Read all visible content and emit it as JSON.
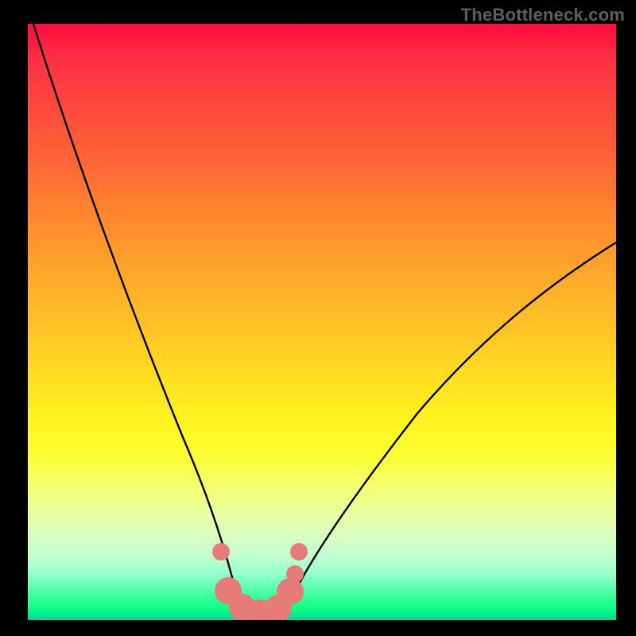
{
  "watermark": "TheBottleneck.com",
  "colors": {
    "frame": "#000000",
    "curve": "#000000",
    "marker": "#e77b78",
    "watermark_text": "#5e5e5e"
  },
  "chart_data": {
    "type": "line",
    "title": "",
    "xlabel": "",
    "ylabel": "",
    "xlim": [
      0,
      100
    ],
    "ylim": [
      0,
      100
    ],
    "grid": false,
    "legend": false,
    "note": "Axes have no tick labels; values below are estimated from pixel positions on a 0–100 normalized scale. Curve series describe path anchors (Bezier-approximated V shape).",
    "series": [
      {
        "name": "left-curve",
        "x": [
          1.0,
          6.5,
          12.0,
          18.0,
          23.5,
          27.5,
          30.5,
          33.0,
          35.0
        ],
        "y": [
          100.0,
          81.0,
          62.0,
          44.0,
          28.0,
          18.0,
          10.5,
          6.0,
          3.0
        ]
      },
      {
        "name": "valley-floor",
        "x": [
          35.0,
          37.0,
          40.0,
          43.0,
          45.0
        ],
        "y": [
          3.0,
          1.7,
          1.0,
          1.6,
          3.0
        ]
      },
      {
        "name": "right-curve",
        "x": [
          45.0,
          50.0,
          56.5,
          65.0,
          73.0,
          82.0,
          91.0,
          100.0
        ],
        "y": [
          3.0,
          9.5,
          18.0,
          29.0,
          38.8,
          48.0,
          56.5,
          64.0
        ]
      }
    ],
    "markers": {
      "description": "Rounded pink markers clustered near the valley bottom",
      "points": [
        {
          "x": 32.8,
          "y": 11.5,
          "r": 1.5
        },
        {
          "x": 34.0,
          "y": 5.0,
          "r": 2.3
        },
        {
          "x": 36.5,
          "y": 2.2,
          "r": 2.3
        },
        {
          "x": 39.5,
          "y": 1.2,
          "r": 2.3
        },
        {
          "x": 42.5,
          "y": 2.0,
          "r": 2.3
        },
        {
          "x": 44.5,
          "y": 4.8,
          "r": 2.3
        },
        {
          "x": 46.0,
          "y": 11.5,
          "r": 1.5
        },
        {
          "x": 45.3,
          "y": 7.8,
          "r": 1.5
        }
      ]
    },
    "gradient_stops": [
      {
        "pos": 0,
        "color": "#ff0b42"
      },
      {
        "pos": 20,
        "color": "#ff5b39"
      },
      {
        "pos": 42,
        "color": "#ffa82b"
      },
      {
        "pos": 66,
        "color": "#fff31f"
      },
      {
        "pos": 86,
        "color": "#d8ffc0"
      },
      {
        "pos": 98,
        "color": "#12ff83"
      },
      {
        "pos": 100,
        "color": "#03d2a2"
      }
    ]
  }
}
